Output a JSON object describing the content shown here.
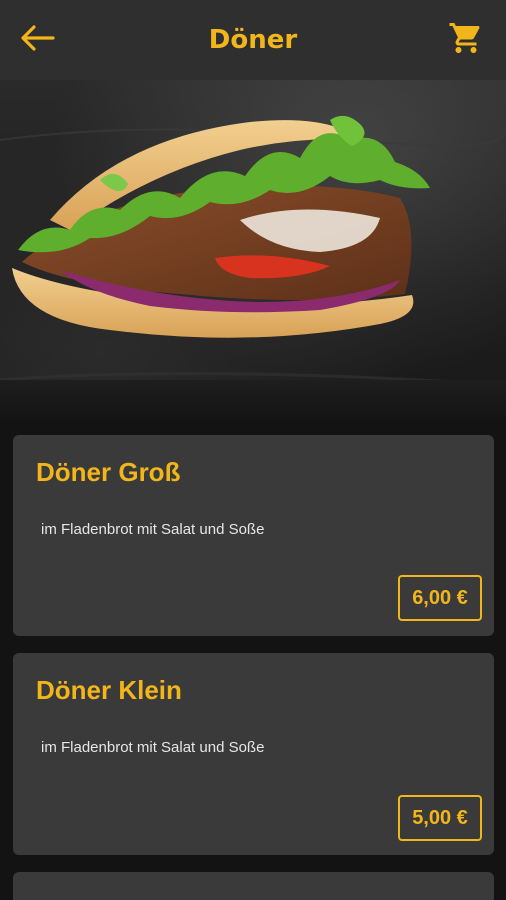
{
  "header": {
    "title": "Döner",
    "back_icon": "arrow-left-icon",
    "cart_icon": "shopping-cart-icon"
  },
  "hero": {
    "image": "doner-sandwich-photo"
  },
  "colors": {
    "accent": "#f2b51a",
    "header_bg": "#2f2f2f",
    "card_bg": "#3a3a3a",
    "page_bg": "#131313"
  },
  "items": [
    {
      "name": "Döner Groß",
      "description": "im Fladenbrot mit Salat und Soße",
      "price": "6,00 €"
    },
    {
      "name": "Döner Klein",
      "description": "im Fladenbrot mit Salat und Soße",
      "price": "5,00 €"
    }
  ]
}
